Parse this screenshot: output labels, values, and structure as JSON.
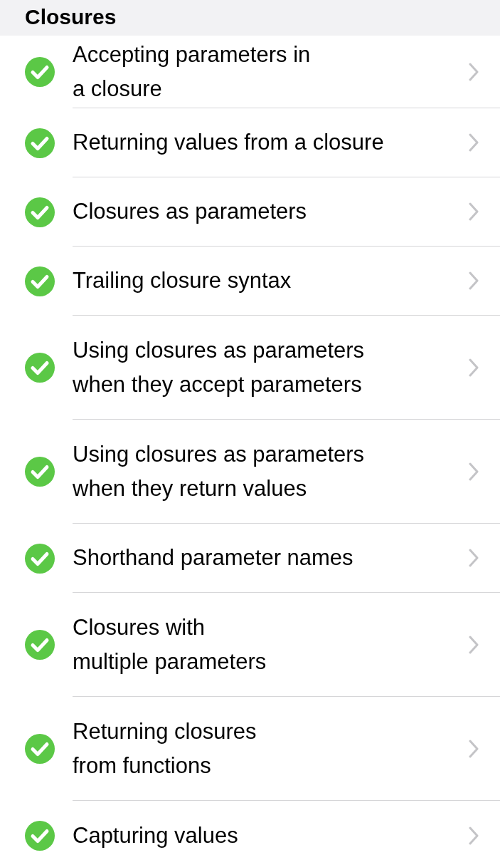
{
  "header": {
    "title": "Closures"
  },
  "lessons": [
    {
      "title": "Accepting parameters in\na closure",
      "completed": true
    },
    {
      "title": "Returning values from a closure",
      "completed": true
    },
    {
      "title": "Closures as parameters",
      "completed": true
    },
    {
      "title": "Trailing closure syntax",
      "completed": true
    },
    {
      "title": "Using closures as parameters\nwhen they accept parameters",
      "completed": true
    },
    {
      "title": "Using closures as parameters\nwhen they return values",
      "completed": true
    },
    {
      "title": "Shorthand parameter names",
      "completed": true
    },
    {
      "title": "Closures with\nmultiple parameters",
      "completed": true
    },
    {
      "title": "Returning closures\nfrom functions",
      "completed": true
    },
    {
      "title": "Capturing values",
      "completed": true
    }
  ]
}
